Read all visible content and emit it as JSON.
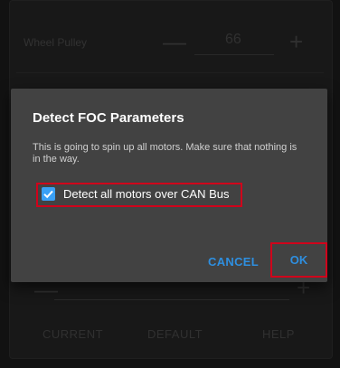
{
  "background": {
    "row1_label": "Wheel Pulley",
    "row1_value": "66",
    "row2_value": "",
    "buttons": [
      "CURRENT",
      "DEFAULT",
      "HELP"
    ]
  },
  "dialog": {
    "title": "Detect FOC Parameters",
    "message": "This is going to spin up all motors. Make sure that nothing is in the way.",
    "checkbox_label": "Detect all motors over CAN Bus",
    "checkbox_checked": true,
    "cancel_label": "CANCEL",
    "ok_label": "OK"
  },
  "colors": {
    "accent": "#2e8fe0",
    "highlight": "#d0021b"
  }
}
